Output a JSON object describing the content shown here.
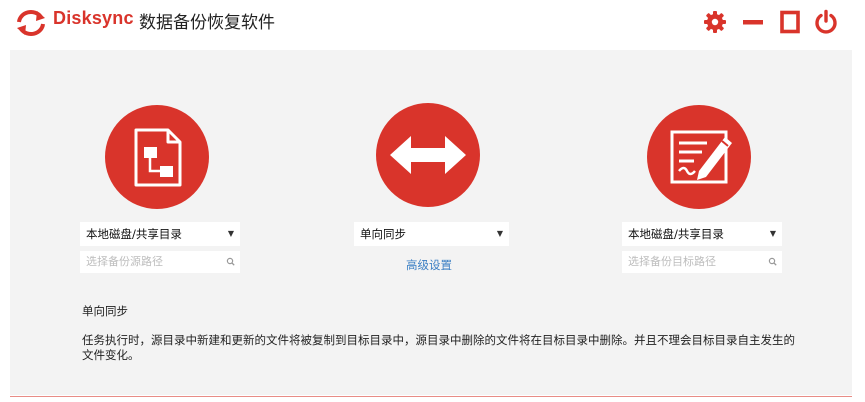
{
  "app": {
    "name": "Disksync",
    "subtitle": "数据备份恢复软件",
    "brand_color": "#d9342b"
  },
  "window_controls": [
    "gear-icon",
    "minimize-icon",
    "maximize-icon",
    "power-icon"
  ],
  "source": {
    "icon": "file-flow-icon",
    "select_value": "本地磁盘/共享目录",
    "path_placeholder": "选择备份源路径"
  },
  "mode": {
    "icon": "double-arrow-icon",
    "select_value": "单向同步",
    "advanced_link": "高级设置"
  },
  "target": {
    "icon": "edit-document-icon",
    "select_value": "本地磁盘/共享目录",
    "path_placeholder": "选择备份目标路径"
  },
  "description": {
    "title": "单向同步",
    "text": "任务执行时，源目录中新建和更新的文件将被复制到目标目录中，源目录中删除的文件将在目标目录中删除。并且不理会目标目录自主发生的文件变化。"
  }
}
